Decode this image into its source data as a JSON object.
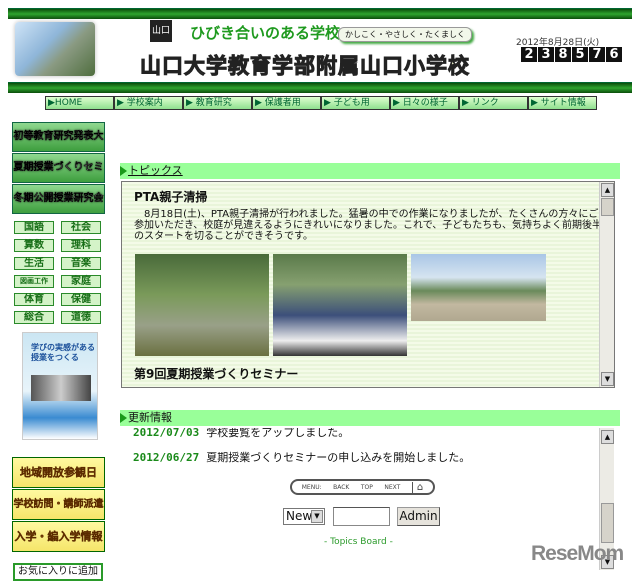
{
  "header": {
    "tagline": "ひびき合いのある学校",
    "motto": "かしこく・やさしく・たくましく",
    "school_name": "山口大学教育学部附属山口小学校",
    "date": "2012年8月28日(火)",
    "counter": [
      "2",
      "3",
      "8",
      "5",
      "7",
      "6"
    ],
    "emblem": "山口"
  },
  "nav": [
    "▶HOME",
    "▶ 学校案内",
    "▶ 教育研究",
    "▶ 保護者用",
    "▶ 子ども用",
    "▶ 日々の様子",
    "▶ リンク",
    "▶ サイト情報"
  ],
  "sidebar": {
    "big_buttons": [
      "初等教育研究発表大会",
      "夏期授業づくりセミナー",
      "冬期公開授業研究会"
    ],
    "subjects": [
      "国語",
      "社会",
      "算数",
      "理科",
      "生活",
      "音楽",
      "図画工作",
      "家庭",
      "体育",
      "保健",
      "総合",
      "道徳"
    ],
    "book": {
      "title": "学びの実感がある授業をつくる"
    },
    "yellow_buttons": [
      "地域開放参観日",
      "学校訪問・講師派遣",
      "入学・編入学情報"
    ],
    "favorite": "お気に入りに追加"
  },
  "topics": {
    "heading": "トピックス",
    "items": [
      {
        "title": "PTA親子清掃",
        "body": "　8月18日(土)、PTA親子清掃が行われました。猛暑の中での作業になりましたが、たくさんの方々にご参加いただき、校庭が見違えるようにきれいになりました。これで、子どもたちも、気持ちよく前期後半のスタートを切ることができそうです。"
      },
      {
        "title": "第9回夏期授業づくりセミナー"
      }
    ]
  },
  "updates": {
    "heading": "更新情報",
    "rows": [
      {
        "date": "2012/07/03",
        "text": "学校要覧をアップしました。"
      },
      {
        "date": "2012/06/27",
        "text": "夏期授業づくりセミナーの申し込みを開始しました。"
      }
    ],
    "menu": {
      "label": "MENU:",
      "back": "BACK",
      "top": "TOP",
      "next": "NEXT"
    },
    "select_value": "New",
    "admin_label": "Admin",
    "board_label": "- Topics Board -"
  },
  "watermark": "ReseMom"
}
